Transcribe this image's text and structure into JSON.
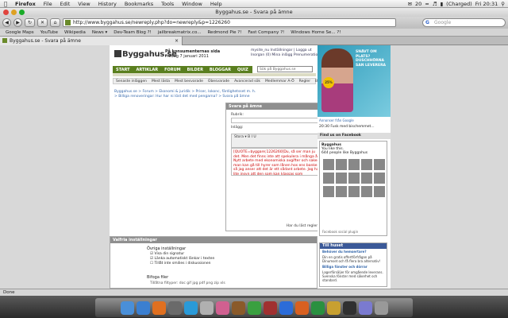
{
  "menubar": {
    "app": "Firefox",
    "items": [
      "File",
      "Edit",
      "View",
      "History",
      "Bookmarks",
      "Tools",
      "Window",
      "Help"
    ],
    "status": "(Charged)",
    "clock": "Fri 20:31",
    "mail_count": "20"
  },
  "window": {
    "title": "Byggahus.se - Svara på ämne"
  },
  "toolbar": {
    "url": "http://www.byggahus.se/newreply.php?do=newreply&p=1226260",
    "search_placeholder": "Google",
    "search_engine": "G"
  },
  "bookmarks": [
    "Google Maps",
    "YouTube",
    "Wikipedia",
    "News ▾",
    "Dev-Team Blog ?!",
    "jailbreakmatrix.co...",
    "Redmond Pie ?!",
    "Fast Company ?!",
    "Windows Home Se... ?!"
  ],
  "tab": {
    "label": "Byggahus.se - Svara på ämne"
  },
  "site": {
    "logo": "Byggahus.se",
    "tagline_title": "På konsumenternas sida",
    "tagline_date": "Fredag 7 januari 2011",
    "user_line1": "mysite_nu Inställningar | Logga ut",
    "user_line2": "Inorgan (0)  Mina inlägg  Prenumerationer",
    "search_placeholder": "Sök på Byggahus.se",
    "nav": [
      "START",
      "ARTIKLAR",
      "FORUM",
      "BILDER",
      "BLOGGAR",
      "QUIZ",
      "WIKI"
    ],
    "subnav": [
      "Senaste inläggen",
      "Mest lästa",
      "Mest besvarade",
      "Obesvarade",
      "Avancerad sök",
      "Medlemmar A-Ö",
      "Regler",
      "Bredda sidan"
    ],
    "crumbs": "Byggahus.se > Forum > Ekonomi & juridik > Priser, lokonc, färdighetsset m. h. > Billiga renoveringar: Hur har ni löst det med pengarna? > Svara på ämne"
  },
  "reply": {
    "heading": "Svara på ämne",
    "subject_label": "Rubrik:",
    "post_label": "Inlägg:",
    "toolbar_row1": "Stora ▾  B  I  U",
    "toolbar_row2": "",
    "text": "[QUOTE=byggare;1226260]Du, så ser man ju det. Men det finns inte att spekulera i många år. Nytt arbete med ekonomiska avgifter och saker man kan gå till hyrer som lånen hos ens banker så jag anser att det är ett sådant arbete. Jag har lite insyn att den som kan klassas som hemmahörande i lingonarbete är fattig. [/QUOTE]",
    "footer": "Har du läst reglerna?"
  },
  "options": {
    "heading": "Valfria inställningar",
    "misc_heading": "Övriga inställningar",
    "opt1": "Visa din signatur",
    "opt2": "Länka automatiskt länkar i texten",
    "opt3": "Tillåt inte smilies i diskussionen",
    "attachments_heading": "Bifoga filer",
    "attachments_note": "Tillåtna filtyper: doc gif jpg pdf png zip xls"
  },
  "right": {
    "ad_text": "SNÄVT OM PLATS? DUSCHHÖRNA SAN LEVERERA",
    "ad_badge": "25%",
    "ad_note": "Annonser från Google",
    "visitors": "20:30 Fusk med bischemmet...",
    "fb_heading": "Find us on Facebook",
    "fb_page": "Byggahus",
    "fb_like": "You like this.",
    "fb_count": "644 people like Byggahus",
    "fb_plugin": "Facebook social plugin",
    "till_heading": "Till huset",
    "till_1_title": "Behöver du hemsertare?",
    "till_1_text": "Din en gratis offertförfrågan på Dinumset och få flera bra alternativ!",
    "till_2_title": "Billiga fönster och dörrar",
    "till_2_text": "Lagerförsäljer för omgående leverans. Svenska fönster med säkerhet och standard."
  },
  "statusbar": {
    "text": "Done"
  },
  "colors": {
    "nav_green": "#5a7f1f",
    "facebook_blue": "#3b5998"
  }
}
